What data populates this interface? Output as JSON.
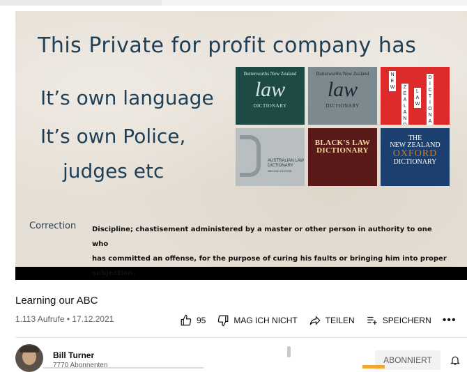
{
  "video": {
    "slide": {
      "heading": "This Private for profit company has",
      "line1": "It’s own language",
      "line2": "It’s own Police,",
      "line3": "judges etc",
      "books": {
        "b1_top": "Butterworths New Zealand",
        "b1_law": "law",
        "b1_dict": "DICTIONARY",
        "b2_top": "Butterworths New Zealand",
        "b2_law": "law",
        "b2_dict": "DICTIONARY",
        "b4_text": "AUSTRALIAN LAW DICTIONARY",
        "b4_edition": "SECOND EDITION",
        "b5_title": "BLACK'S LAW DICTIONARY",
        "b6_the": "THE",
        "b6_nz": "NEW ZEALAND",
        "b6_oxford": "OXFORD",
        "b6_dict": "DICTIONARY"
      },
      "correction_word": "Correction",
      "correction_def_1": "Discipline; chastisement administered by a master or other person in authority to one who",
      "correction_def_2": "has committed an offense, for the purpose of curing his faults or bringing him into proper",
      "correction_def_3": "subjection."
    }
  },
  "title": "Learning our ABC",
  "meta": "1.113 Aufrufe • 17.12.2021",
  "actions": {
    "like_count": "95",
    "dislike_label": "MAG ICH NICHT",
    "share_label": "TEILEN",
    "save_label": "SPEICHERN",
    "more_label": "•••"
  },
  "channel": {
    "name": "Bill Turner",
    "subscribers": "7770 Abonnenten",
    "subscribe_label": "ABONNIERT"
  },
  "icons": {
    "like": "thumbs-up-icon",
    "dislike": "thumbs-down-icon",
    "share": "share-arrow-icon",
    "save": "playlist-add-icon",
    "bell": "bell-icon"
  }
}
